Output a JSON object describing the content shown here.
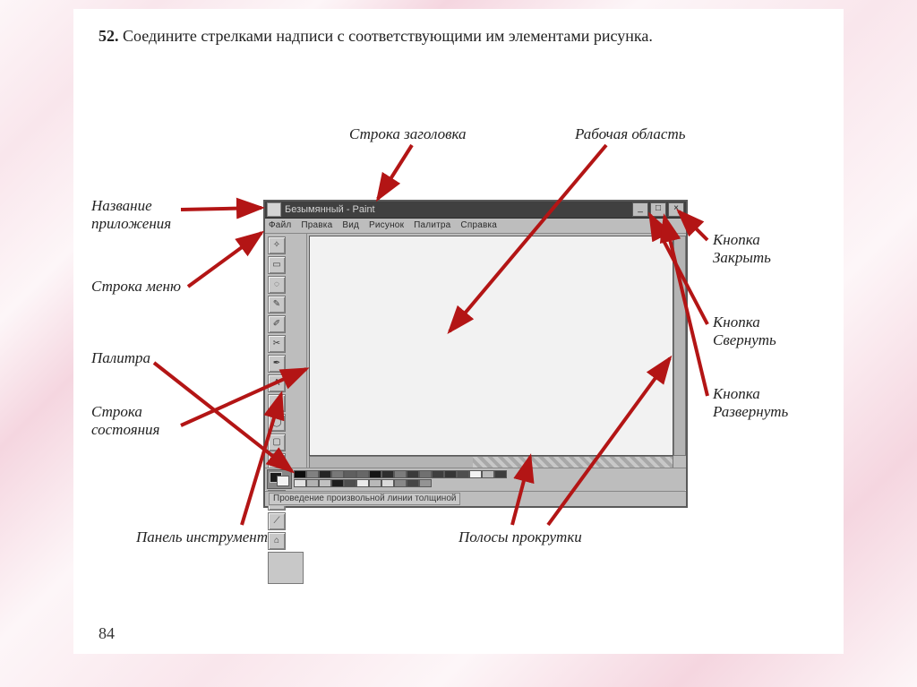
{
  "question": {
    "number": "52.",
    "text": "Соедините стрелками надписи с соответствующими им элементами рисунка."
  },
  "labels": {
    "titlebar": "Строка заголовка",
    "workarea": "Рабочая область",
    "appname_line1": "Название",
    "appname_line2": "приложения",
    "menuline": "Строка меню",
    "palette": "Палитра",
    "status_line1": "Строка",
    "status_line2": "состояния",
    "tools": "Панель инструментов",
    "scrollbars": "Полосы прокрутки",
    "close_line1": "Кнопка",
    "close_line2": "Закрыть",
    "min_line1": "Кнопка",
    "min_line2": "Свернуть",
    "max_line1": "Кнопка",
    "max_line2": "Развернуть"
  },
  "paint_window": {
    "title": "Безымянный - Paint",
    "menus": [
      "Файл",
      "Правка",
      "Вид",
      "Рисунок",
      "Палитра",
      "Справка"
    ],
    "status_text": "Проведение произвольной линии толщиной",
    "control_glyphs": {
      "minimize": "_",
      "maximize": "□",
      "close": "×"
    },
    "palette_colors": [
      "#000",
      "#808080",
      "#800000",
      "#808000",
      "#008000",
      "#008080",
      "#000080",
      "#800080",
      "#808040",
      "#004040",
      "#0080ff",
      "#004080",
      "#8000ff",
      "#804000",
      "#fff",
      "#c0c0c0",
      "#ff0000",
      "#ffff00",
      "#00ff00",
      "#00ffff",
      "#0000ff",
      "#ff00ff",
      "#ffff80",
      "#00ff80",
      "#80ffff",
      "#8080ff",
      "#ff0080",
      "#ff8040"
    ],
    "tool_glyphs": [
      "✧",
      "▭",
      "◌",
      "✎",
      "✐",
      "✂",
      "✒",
      "A",
      "／",
      "◯",
      "▢",
      "⬠",
      "◇",
      "⬭",
      "⟋",
      "⌂"
    ]
  },
  "page_number": "84",
  "arrow_color": "#b31515"
}
